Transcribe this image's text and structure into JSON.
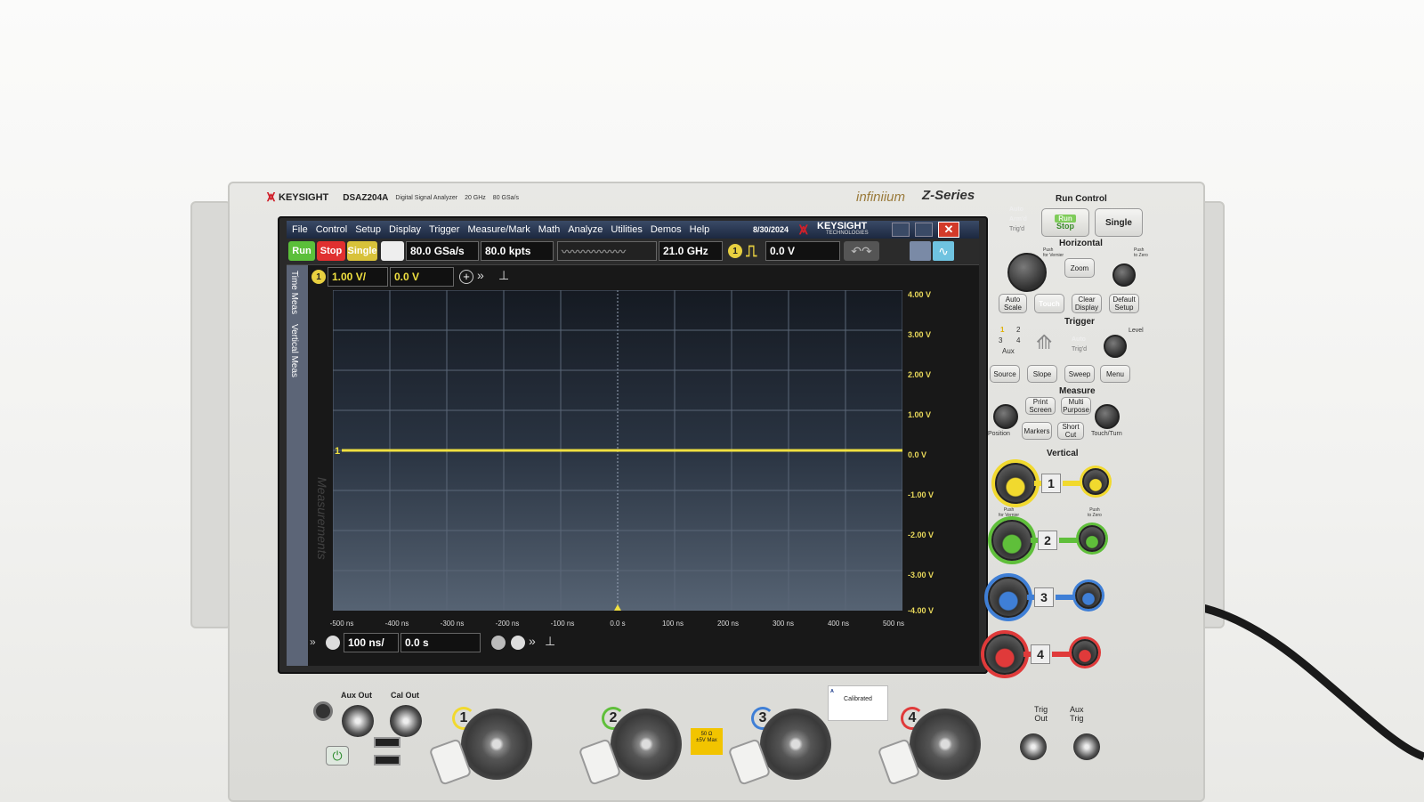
{
  "instrument": {
    "brand": "KEYSIGHT",
    "model": "DSAZ204A",
    "description": "Digital Signal Analyzer",
    "bandwidth": "20 GHz",
    "sample_rate": "80 GSa/s",
    "series_logo": "infiniium",
    "series": "Z-Series"
  },
  "screen": {
    "menu": [
      "File",
      "Control",
      "Setup",
      "Display",
      "Trigger",
      "Measure/Mark",
      "Math",
      "Analyze",
      "Utilities",
      "Demos",
      "Help"
    ],
    "date": "8/30/2024",
    "screen_logo": "KEYSIGHT",
    "screen_logo_sub": "TECHNOLOGIES",
    "toolbar": {
      "run": "Run",
      "stop": "Stop",
      "single": "Single",
      "sample_rate": "80.0 GSa/s",
      "memory_depth": "80.0 kpts",
      "bandwidth": "21.0 GHz",
      "trigger_channel": "1",
      "trigger_level": "0.0 V"
    },
    "channel": {
      "number": "1",
      "scale": "1.00 V/",
      "offset": "0.0 V"
    },
    "side_tabs": [
      "Time Meas",
      "Vertical Meas"
    ],
    "measurements_label": "Measurements",
    "y_axis_labels": [
      "4.00 V",
      "3.00 V",
      "2.00 V",
      "1.00 V",
      "0.0 V",
      "-1.00 V",
      "-2.00 V",
      "-3.00 V",
      "-4.00 V"
    ],
    "x_axis_labels": [
      "-500 ns",
      "-400 ns",
      "-300 ns",
      "-200 ns",
      "-100 ns",
      "0.0 s",
      "100 ns",
      "200 ns",
      "300 ns",
      "400 ns",
      "500 ns"
    ],
    "timebase": {
      "scale": "100 ns/",
      "position": "0.0 s"
    },
    "trace_color": "#f0e040",
    "trace_level_volts": 0.0
  },
  "front_panel": {
    "run_control": {
      "title": "Run Control",
      "auto_lbl": "Auto",
      "armd_lbl": "Arm'd",
      "trigd_lbl": "Trig'd",
      "run_stop_top": "Run",
      "run_stop_bottom": "Stop",
      "single": "Single"
    },
    "horizontal": {
      "title": "Horizontal",
      "zoom": "Zoom",
      "push_vernier": "Push\nfor Vernier",
      "push_zero": "Push\nto Zero",
      "auto_scale": "Auto\nScale",
      "touch": "Touch",
      "clear_display": "Clear\nDisplay",
      "default_setup": "Default\nSetup"
    },
    "trigger": {
      "title": "Trigger",
      "level": "Level",
      "ch_1": "1",
      "ch_2": "2",
      "ch_3": "3",
      "ch_4": "4",
      "aux": "Aux",
      "auto_lbl": "Auto",
      "trigd_lbl": "Trig'd",
      "source": "Source",
      "slope": "Slope",
      "sweep": "Sweep",
      "menu": "Menu"
    },
    "measure": {
      "title": "Measure",
      "print_screen": "Print\nScreen",
      "multi_purpose": "Multi\nPurpose",
      "markers": "Markers",
      "short_cut": "Short\nCut",
      "position": "Position",
      "touch_turn": "Touch/Turn"
    },
    "vertical": {
      "title": "Vertical",
      "channels": [
        "1",
        "2",
        "3",
        "4"
      ],
      "colors": [
        "#f1d92e",
        "#5fbf3a",
        "#3f7fd6",
        "#e03a3a"
      ],
      "push_vernier": "Push\nfor Vernier",
      "push_zero": "Push\nto Zero"
    },
    "bottom": {
      "aux_out": "Aux Out",
      "cal_out": "Cal Out",
      "trig_out": "Trig\nOut",
      "aux_trig": "Aux\nTrig",
      "input_numbers": [
        "1",
        "2",
        "3",
        "4"
      ],
      "input_warning": "50 Ω\n±5V Max",
      "cal_sticker_title": "Calibrated"
    }
  }
}
